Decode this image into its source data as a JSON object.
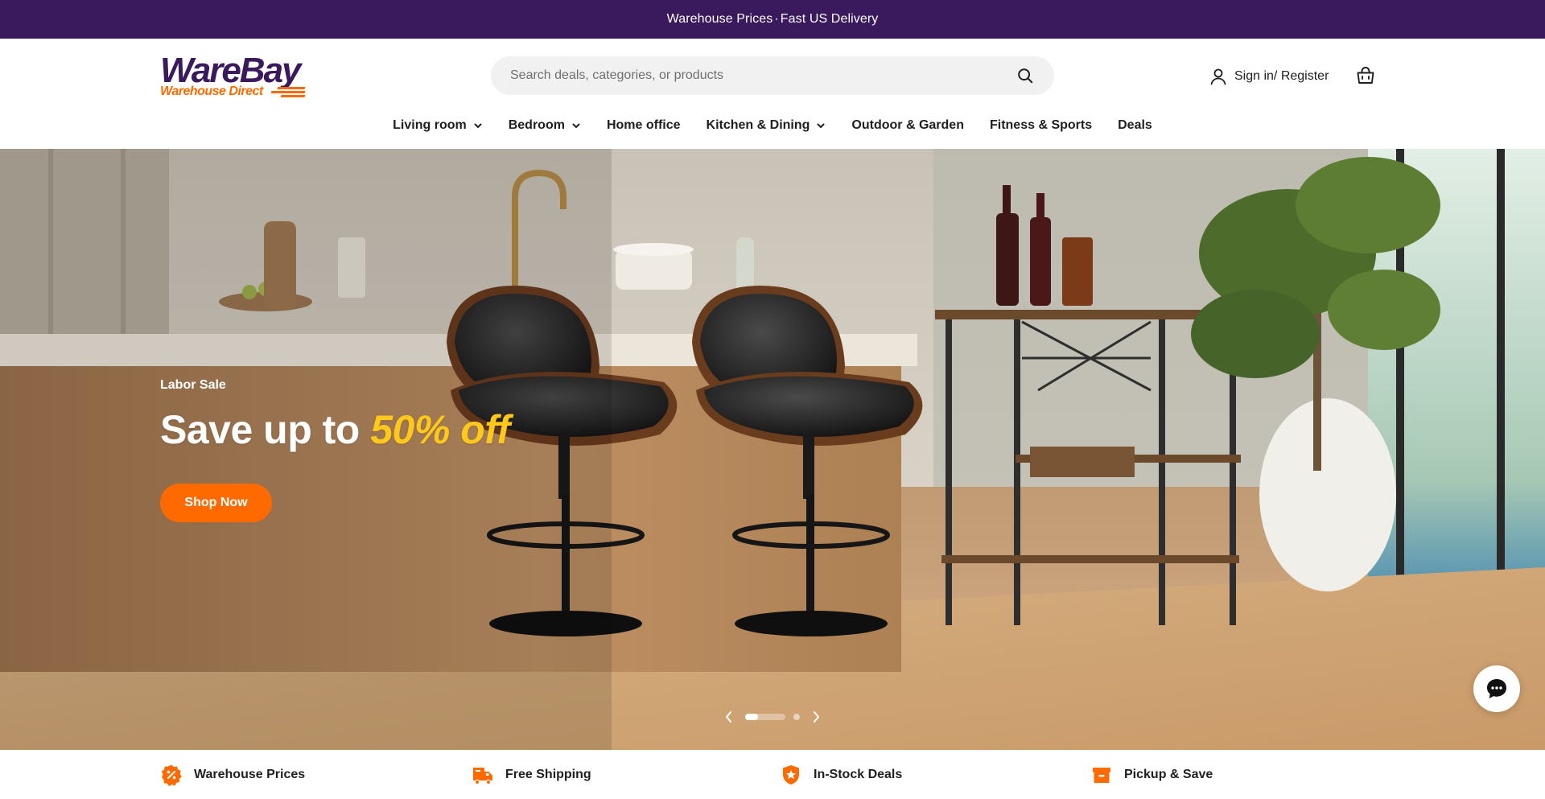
{
  "announcement": {
    "part1": "Warehouse Prices",
    "separator": "·",
    "part2": "Fast US Delivery"
  },
  "header": {
    "logo": {
      "main": "WareBay",
      "sub": "Warehouse Direct"
    },
    "search": {
      "placeholder": "Search deals, categories, or products",
      "value": ""
    },
    "account_label": "Sign in/ Register"
  },
  "nav": [
    {
      "label": "Living room",
      "dropdown": true
    },
    {
      "label": "Bedroom",
      "dropdown": true
    },
    {
      "label": "Home office",
      "dropdown": false
    },
    {
      "label": "Kitchen & Dining",
      "dropdown": true
    },
    {
      "label": "Outdoor & Garden",
      "dropdown": false
    },
    {
      "label": "Fitness & Sports",
      "dropdown": false
    },
    {
      "label": "Deals",
      "dropdown": false
    }
  ],
  "hero": {
    "eyebrow": "Labor Sale",
    "title_prefix": "Save up to ",
    "title_accent": "50% off",
    "cta": "Shop Now",
    "slides_total": 3,
    "active_slide": 1
  },
  "features": [
    {
      "label": "Warehouse Prices",
      "icon": "percent-badge-icon"
    },
    {
      "label": "Free Shipping",
      "icon": "truck-icon"
    },
    {
      "label": "In-Stock Deals",
      "icon": "star-shield-icon"
    },
    {
      "label": "Pickup & Save",
      "icon": "box-icon"
    }
  ],
  "colors": {
    "brand_purple": "#3a1a5c",
    "brand_orange": "#ff6a00",
    "accent_yellow": "#ffc81a"
  }
}
